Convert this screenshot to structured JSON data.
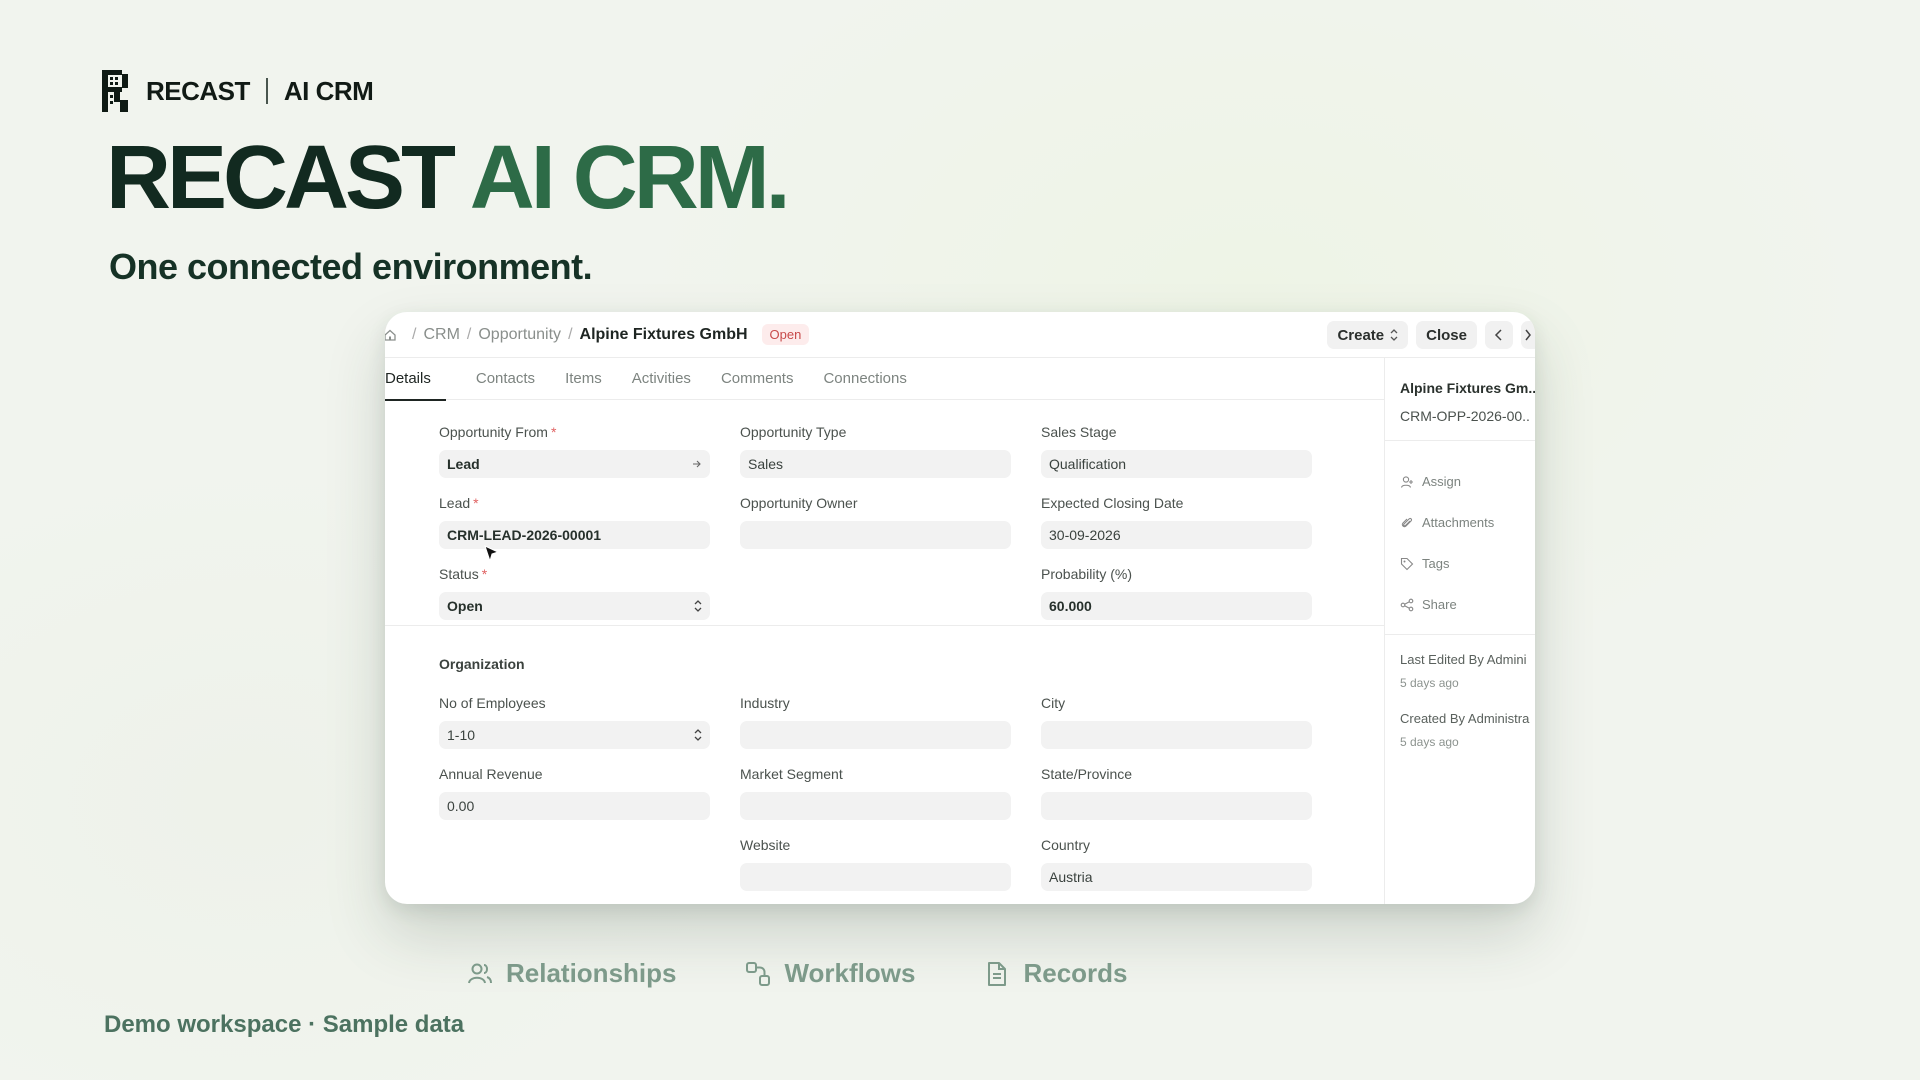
{
  "brand": {
    "name": "RECAST",
    "product": "AI CRM"
  },
  "hero": {
    "title_main": "RECAST",
    "title_accent": "AI CRM.",
    "subtitle": "One connected environment."
  },
  "app": {
    "breadcrumb": {
      "items": [
        "CRM",
        "Opportunity"
      ],
      "current": "Alpine Fixtures GmbH",
      "status_badge": "Open"
    },
    "actions": {
      "create": "Create",
      "close": "Close"
    },
    "tabs": [
      "Details",
      "Contacts",
      "Items",
      "Activities",
      "Comments",
      "Connections"
    ],
    "fields": {
      "opportunity_from": {
        "label": "Opportunity From",
        "value": "Lead"
      },
      "opportunity_type": {
        "label": "Opportunity Type",
        "value": "Sales"
      },
      "sales_stage": {
        "label": "Sales Stage",
        "value": "Qualification"
      },
      "lead": {
        "label": "Lead",
        "value": "CRM-LEAD-2026-00001"
      },
      "opportunity_owner": {
        "label": "Opportunity Owner",
        "value": ""
      },
      "expected_closing_date": {
        "label": "Expected Closing Date",
        "value": "30-09-2026"
      },
      "status": {
        "label": "Status",
        "value": "Open"
      },
      "probability": {
        "label": "Probability (%)",
        "value": "60.000"
      },
      "no_of_employees": {
        "label": "No of Employees",
        "value": "1-10"
      },
      "industry": {
        "label": "Industry",
        "value": ""
      },
      "city": {
        "label": "City",
        "value": ""
      },
      "annual_revenue": {
        "label": "Annual Revenue",
        "value": "0.00"
      },
      "market_segment": {
        "label": "Market Segment",
        "value": ""
      },
      "state_province": {
        "label": "State/Province",
        "value": ""
      },
      "website": {
        "label": "Website",
        "value": ""
      },
      "country": {
        "label": "Country",
        "value": "Austria"
      }
    },
    "section_organization": "Organization",
    "sidebar": {
      "title": "Alpine Fixtures Gm..",
      "doc_id": "CRM-OPP-2026-00..",
      "actions": {
        "assign": "Assign",
        "attachments": "Attachments",
        "tags": "Tags",
        "share": "Share"
      },
      "last_edited": "Last Edited By Admini",
      "last_edited_ago": "5 days ago",
      "created": "Created By Administra",
      "created_ago": "5 days ago"
    }
  },
  "features": {
    "relationships": "Relationships",
    "workflows": "Workflows",
    "records": "Records"
  },
  "footer": "Demo workspace · Sample data"
}
